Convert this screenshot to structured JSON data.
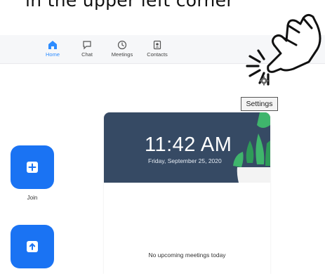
{
  "caption": "in the upper left corner",
  "nav": {
    "items": [
      {
        "label": "Home",
        "icon": "home-icon",
        "active": true
      },
      {
        "label": "Chat",
        "icon": "chat-icon",
        "active": false
      },
      {
        "label": "Meetings",
        "icon": "clock-icon",
        "active": false
      },
      {
        "label": "Contacts",
        "icon": "contacts-icon",
        "active": false
      }
    ]
  },
  "settings": {
    "icon": "gear-icon",
    "tooltip": "Settings"
  },
  "actions": [
    {
      "label": "Join",
      "icon": "plus-icon"
    },
    {
      "label": "",
      "icon": "share-screen-icon"
    }
  ],
  "meeting_card": {
    "time": "11:42 AM",
    "date": "Friday, September 25, 2020",
    "empty_message": "No upcoming meetings today"
  },
  "colors": {
    "accent": "#2d8cff",
    "button_blue": "#1a73f3",
    "card_header": "#364a64",
    "plant_green": "#3fb56c"
  }
}
